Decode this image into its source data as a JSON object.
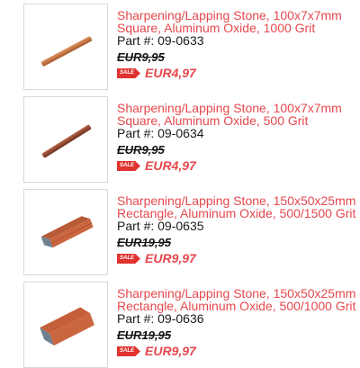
{
  "products": [
    {
      "title_line1": "Sharpening/Lapping Stone, 100x7x7mm",
      "title_line2": "Square, Aluminum Oxide, 1000 Grit",
      "part": "Part #: 09-0633",
      "old_price": "EUR9,95",
      "sale_badge": "SALE",
      "new_price": "EUR4,97",
      "image_icon": "square-stone-icon",
      "stone_color": "#c9743f"
    },
    {
      "title_line1": "Sharpening/Lapping Stone, 100x7x7mm",
      "title_line2": "Square, Aluminum Oxide, 500 Grit",
      "part": "Part #: 09-0634",
      "old_price": "EUR9,95",
      "sale_badge": "SALE",
      "new_price": "EUR4,97",
      "image_icon": "square-stone-icon",
      "stone_color": "#9a4a2e"
    },
    {
      "title_line1": "Sharpening/Lapping Stone, 150x50x25mm",
      "title_line2": "Rectangle, Aluminum Oxide, 500/1500 Grit",
      "part": "Part #: 09-0635",
      "old_price": "EUR19,95",
      "sale_badge": "SALE",
      "new_price": "EUR9,97",
      "image_icon": "rectangle-stone-icon",
      "stone_color": "#c8603a"
    },
    {
      "title_line1": "Sharpening/Lapping Stone, 150x50x25mm",
      "title_line2": "Rectangle, Aluminum Oxide, 500/1000 Grit",
      "part": "Part #: 09-0636",
      "old_price": "EUR19,95",
      "sale_badge": "SALE",
      "new_price": "EUR9,97",
      "image_icon": "rectangle-stone-icon",
      "stone_color": "#c8603a"
    }
  ],
  "colors": {
    "accent": "#e5484d",
    "sale_badge_bg": "#e0322f"
  }
}
